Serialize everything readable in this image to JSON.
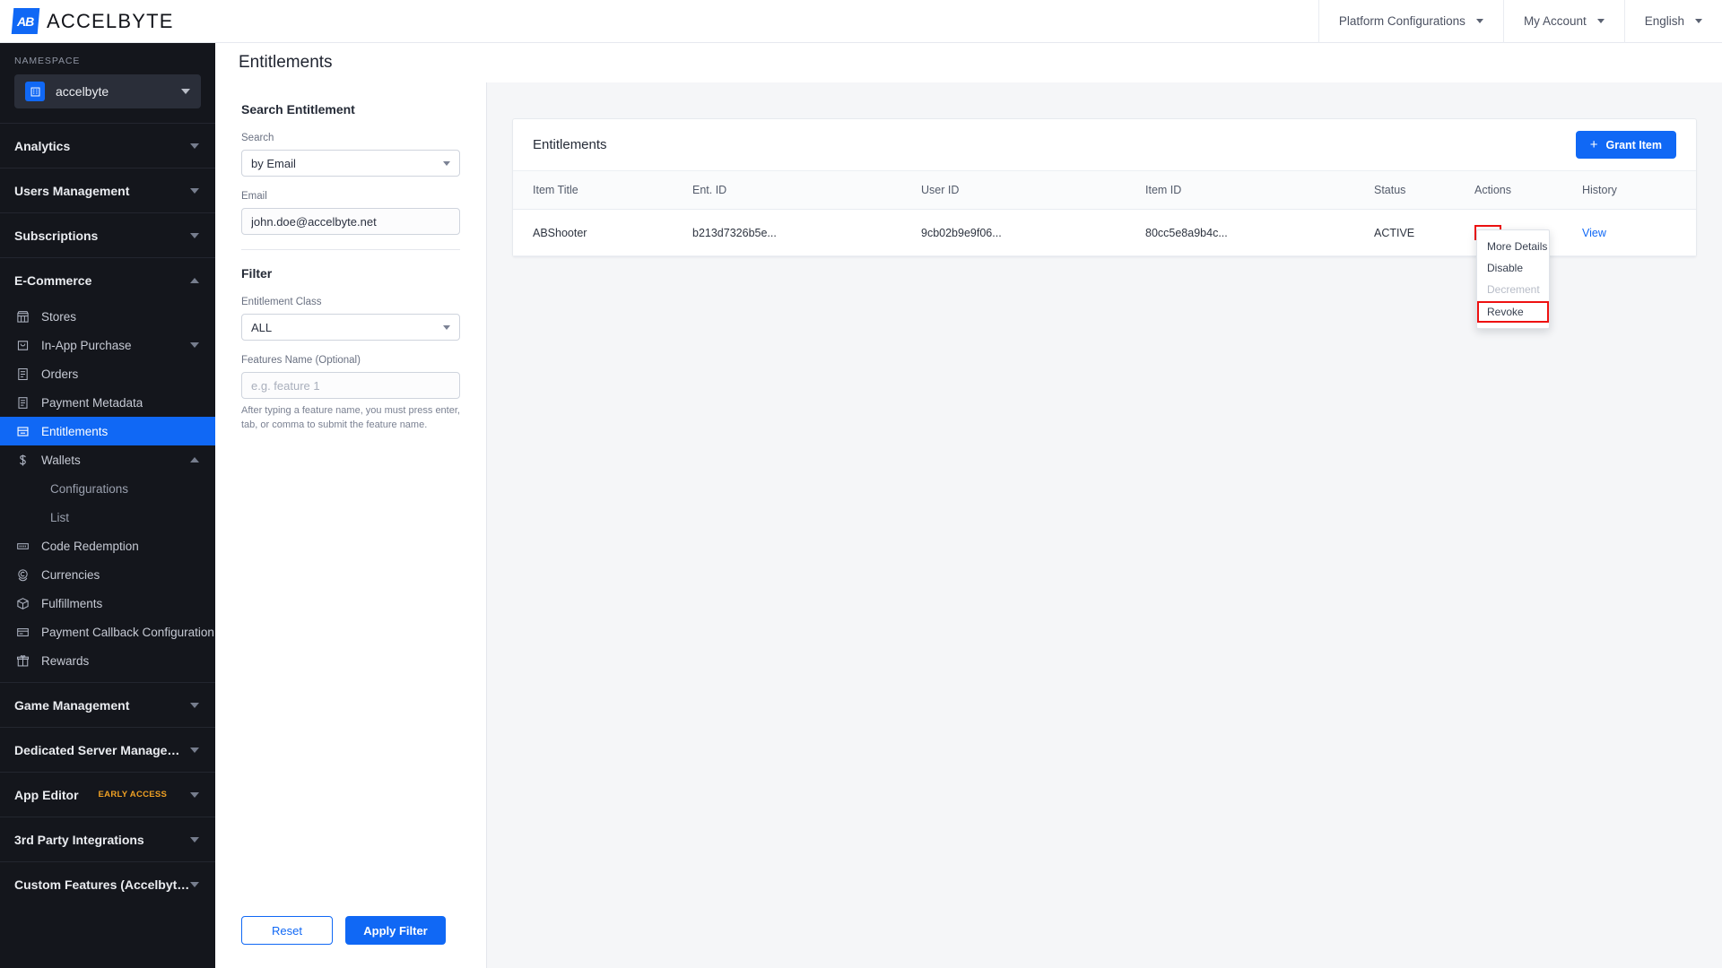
{
  "topbar": {
    "brand_mark": "AB",
    "brand_text": "ACCELBYTE",
    "nav": [
      {
        "label": "Platform Configurations"
      },
      {
        "label": "My Account"
      },
      {
        "label": "English"
      }
    ]
  },
  "sidebar": {
    "namespace_label": "NAMESPACE",
    "namespace_value": "accelbyte",
    "groups": [
      {
        "label": "Analytics",
        "expanded": false,
        "badge": ""
      },
      {
        "label": "Users Management",
        "expanded": false,
        "badge": ""
      },
      {
        "label": "Subscriptions",
        "expanded": false,
        "badge": ""
      },
      {
        "label": "E-Commerce",
        "expanded": true,
        "badge": ""
      },
      {
        "label": "Game Management",
        "expanded": false,
        "badge": ""
      },
      {
        "label": "Dedicated Server Management",
        "expanded": false,
        "badge": ""
      },
      {
        "label": "App Editor",
        "expanded": false,
        "badge": "EARLY ACCESS"
      },
      {
        "label": "3rd Party Integrations",
        "expanded": false,
        "badge": ""
      },
      {
        "label": "Custom Features (Accelbyte In...",
        "expanded": false,
        "badge": ""
      }
    ],
    "ecommerce_items": [
      {
        "label": "Stores",
        "icon": "store-icon",
        "active": false,
        "sub": false,
        "expandable": false
      },
      {
        "label": "In-App Purchase",
        "icon": "bag-icon",
        "active": false,
        "sub": false,
        "expandable": true
      },
      {
        "label": "Orders",
        "icon": "receipt-icon",
        "active": false,
        "sub": false,
        "expandable": false
      },
      {
        "label": "Payment Metadata",
        "icon": "document-icon",
        "active": false,
        "sub": false,
        "expandable": false
      },
      {
        "label": "Entitlements",
        "icon": "entitlement-icon",
        "active": true,
        "sub": false,
        "expandable": false
      },
      {
        "label": "Wallets",
        "icon": "dollar-icon",
        "active": false,
        "sub": false,
        "expandable": true
      },
      {
        "label": "Configurations",
        "icon": "",
        "active": false,
        "sub": true,
        "expandable": false
      },
      {
        "label": "List",
        "icon": "",
        "active": false,
        "sub": true,
        "expandable": false
      },
      {
        "label": "Code Redemption",
        "icon": "ticket-icon",
        "active": false,
        "sub": false,
        "expandable": false
      },
      {
        "label": "Currencies",
        "icon": "coin-icon",
        "active": false,
        "sub": false,
        "expandable": false
      },
      {
        "label": "Fulfillments",
        "icon": "box-icon",
        "active": false,
        "sub": false,
        "expandable": false
      },
      {
        "label": "Payment Callback Configuration",
        "icon": "card-icon",
        "active": false,
        "sub": false,
        "expandable": false
      },
      {
        "label": "Rewards",
        "icon": "gift-icon",
        "active": false,
        "sub": false,
        "expandable": false
      }
    ]
  },
  "page": {
    "title": "Entitlements"
  },
  "filter_panel": {
    "search_section_title": "Search Entitlement",
    "search_label": "Search",
    "search_value": "by Email",
    "email_label": "Email",
    "email_value": "john.doe@accelbyte.net",
    "email_placeholder": "",
    "filter_section_title": "Filter",
    "entitlement_class_label": "Entitlement Class",
    "entitlement_class_value": "ALL",
    "features_label": "Features Name (Optional)",
    "features_placeholder": "e.g. feature 1",
    "features_help": "After typing a feature name, you must press enter, tab, or comma to submit the feature name.",
    "reset_label": "Reset",
    "apply_label": "Apply Filter"
  },
  "table_card": {
    "title": "Entitlements",
    "grant_button": "Grant Item",
    "grant_plus": "+",
    "columns": [
      "Item Title",
      "Ent. ID",
      "User ID",
      "Item ID",
      "Status",
      "Actions",
      "History"
    ],
    "rows": [
      {
        "item_title": "ABShooter",
        "ent_id": "b213d7326b5e...",
        "user_id": "9cb02b9e9f06...",
        "item_id": "80cc5e8a9b4c...",
        "status": "ACTIVE",
        "history": "View"
      }
    ]
  },
  "context_menu": {
    "items": [
      {
        "label": "More Details",
        "disabled": false,
        "highlighted": false
      },
      {
        "label": "Disable",
        "disabled": false,
        "highlighted": false
      },
      {
        "label": "Decrement",
        "disabled": true,
        "highlighted": false
      },
      {
        "label": "Revoke",
        "disabled": false,
        "highlighted": true
      }
    ]
  },
  "colors": {
    "accent": "#1068f5",
    "sidebar_bg": "#14161c",
    "highlight_box": "#ee1111",
    "early_access": "#f0a124",
    "content_bg": "#f5f6f8"
  }
}
